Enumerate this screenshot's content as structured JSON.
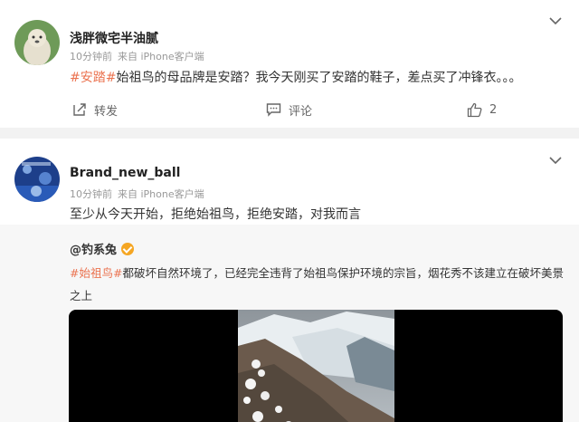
{
  "post1": {
    "username": "浅胖微宅半油腻",
    "time": "10分钟前",
    "source": "来自 iPhone客户端",
    "hashtag": "#安踏#",
    "text": "始祖鸟的母品牌是安踏？我今天刚买了安踏的鞋子，差点买了冲锋衣。。。",
    "actions": {
      "repost": "转发",
      "comment": "评论",
      "like_count": "2"
    }
  },
  "post2": {
    "username": "Brand_new_ball",
    "time": "10分钟前",
    "source": "来自 iPhone客户端",
    "text": "至少从今天开始，拒绝始祖鸟，拒绝安踏，对我而言",
    "repost": {
      "username": "@钓系兔",
      "hashtag": "#始祖鸟#",
      "text": "都破坏自然环境了，已经完全违背了始祖鸟保护环境的宗旨，烟花秀不该建立在破坏美景之上"
    }
  },
  "colors": {
    "accent": "#eb7350",
    "verified": "#f5a623"
  },
  "icons": [
    "chevron-down-icon",
    "repost-icon",
    "comment-icon",
    "like-icon",
    "verified-icon"
  ]
}
